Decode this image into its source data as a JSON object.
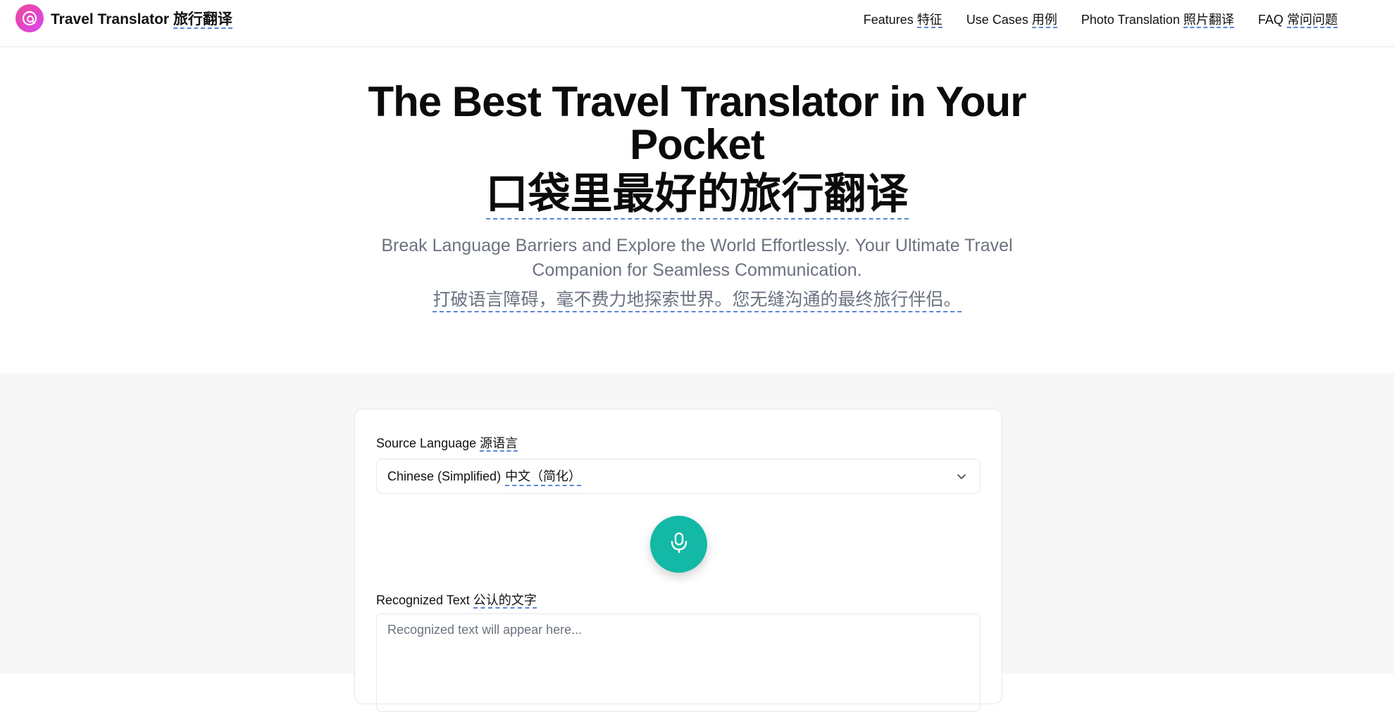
{
  "header": {
    "brand_en": "Travel Translator",
    "brand_zh": "旅行翻译",
    "nav": [
      {
        "en": "Features",
        "zh": "特征"
      },
      {
        "en": "Use Cases",
        "zh": "用例"
      },
      {
        "en": "Photo Translation",
        "zh": "照片翻译"
      },
      {
        "en": "FAQ",
        "zh": "常问问题"
      }
    ]
  },
  "hero": {
    "title_en": "The Best Travel Translator in Your Pocket",
    "title_zh": "口袋里最好的旅行翻译",
    "subtitle_en": "Break Language Barriers and Explore the World Effortlessly. Your Ultimate Travel Companion for Seamless Communication.",
    "subtitle_zh": "打破语言障碍，毫不费力地探索世界。您无缝沟通的最终旅行伴侣。"
  },
  "translator": {
    "source_label_en": "Source Language",
    "source_label_zh": "源语言",
    "source_value_en": "Chinese (Simplified)",
    "source_value_zh": "中文（简化）",
    "recognized_label_en": "Recognized Text",
    "recognized_label_zh": "公认的文字",
    "recognized_placeholder": "Recognized text will appear here..."
  },
  "colors": {
    "accent_pink": "#ec4899",
    "mic_teal": "#14b8a6",
    "underline_blue": "#5b86d6"
  },
  "icons": {
    "logo": "translate-globe-icon",
    "chevron": "chevron-down-icon",
    "mic": "microphone-icon"
  }
}
